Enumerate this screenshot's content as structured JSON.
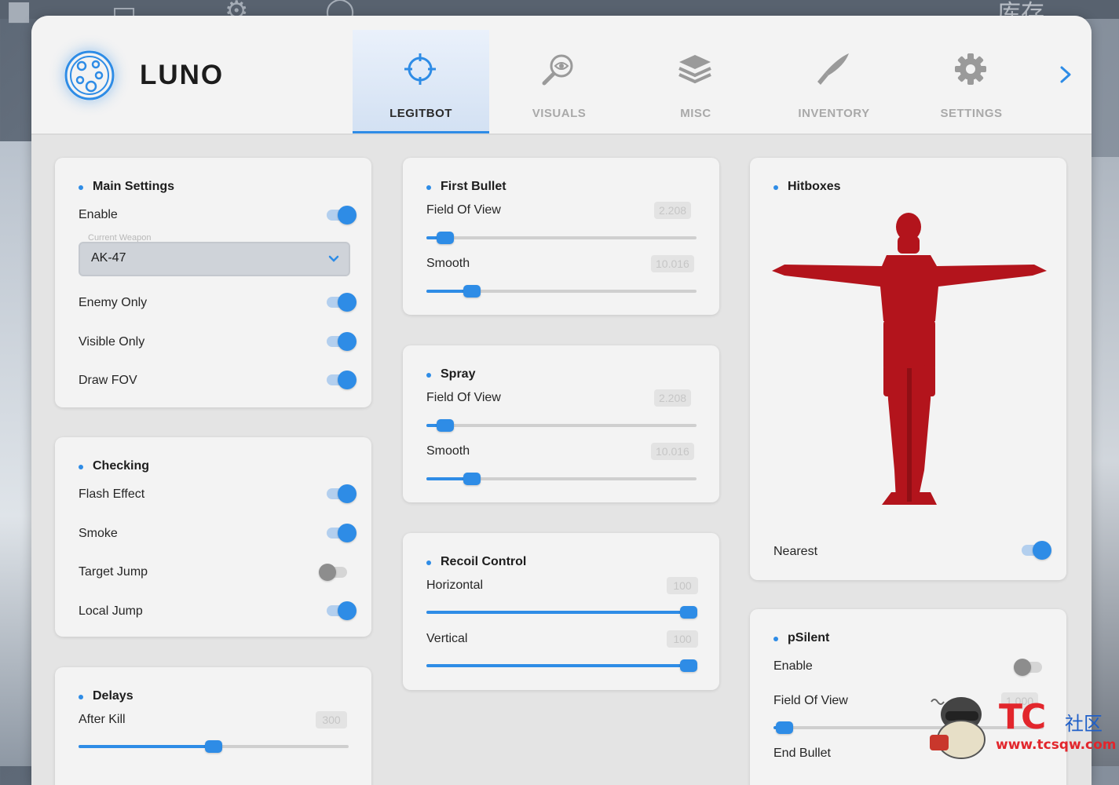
{
  "app": {
    "name": "LUNO"
  },
  "background": {
    "top_right_text": "库存"
  },
  "tabs": [
    {
      "label": "LEGITBOT",
      "icon": "crosshair-icon",
      "active": true
    },
    {
      "label": "VISUALS",
      "icon": "eye-search-icon",
      "active": false
    },
    {
      "label": "MISC",
      "icon": "layers-icon",
      "active": false
    },
    {
      "label": "INVENTORY",
      "icon": "knife-icon",
      "active": false
    },
    {
      "label": "SETTINGS",
      "icon": "gear-icon",
      "active": false
    }
  ],
  "main_settings": {
    "title": "Main Settings",
    "enable": {
      "label": "Enable",
      "on": true
    },
    "weapon": {
      "label": "Current Weapon",
      "value": "AK-47"
    },
    "enemy_only": {
      "label": "Enemy Only",
      "on": true
    },
    "visible_only": {
      "label": "Visible Only",
      "on": true
    },
    "draw_fov": {
      "label": "Draw FOV",
      "on": true
    }
  },
  "checking": {
    "title": "Checking",
    "flash_effect": {
      "label": "Flash Effect",
      "on": true
    },
    "smoke": {
      "label": "Smoke",
      "on": true
    },
    "target_jump": {
      "label": "Target Jump",
      "on": false
    },
    "local_jump": {
      "label": "Local Jump",
      "on": true
    }
  },
  "delays": {
    "title": "Delays",
    "after_kill": {
      "label": "After Kill",
      "value": "300",
      "fraction": 0.5
    }
  },
  "first_bullet": {
    "title": "First Bullet",
    "fov": {
      "label": "Field Of View",
      "value": "2.208",
      "fraction": 0.07
    },
    "smooth": {
      "label": "Smooth",
      "value": "10.016",
      "fraction": 0.17
    }
  },
  "spray": {
    "title": "Spray",
    "fov": {
      "label": "Field Of View",
      "value": "2.208",
      "fraction": 0.07
    },
    "smooth": {
      "label": "Smooth",
      "value": "10.016",
      "fraction": 0.17
    }
  },
  "recoil_control": {
    "title": "Recoil Control",
    "horizontal": {
      "label": "Horizontal",
      "value": "100",
      "fraction": 1.0
    },
    "vertical": {
      "label": "Vertical",
      "value": "100",
      "fraction": 1.0
    }
  },
  "hitboxes": {
    "title": "Hitboxes",
    "nearest": {
      "label": "Nearest",
      "on": true
    },
    "model_color": "#b3141c"
  },
  "psilent": {
    "title": "pSilent",
    "enable": {
      "label": "Enable",
      "on": false
    },
    "fov": {
      "label": "Field Of View",
      "value": "1.000",
      "fraction": 0.04
    },
    "end_bullet": {
      "label": "End Bullet"
    }
  },
  "watermark": {
    "brand": "TC",
    "cn": "社区",
    "url": "www.tcsqw.com"
  },
  "colors": {
    "accent": "#2e8ce6",
    "panel": "#f3f3f3",
    "window": "#e4e4e4"
  }
}
